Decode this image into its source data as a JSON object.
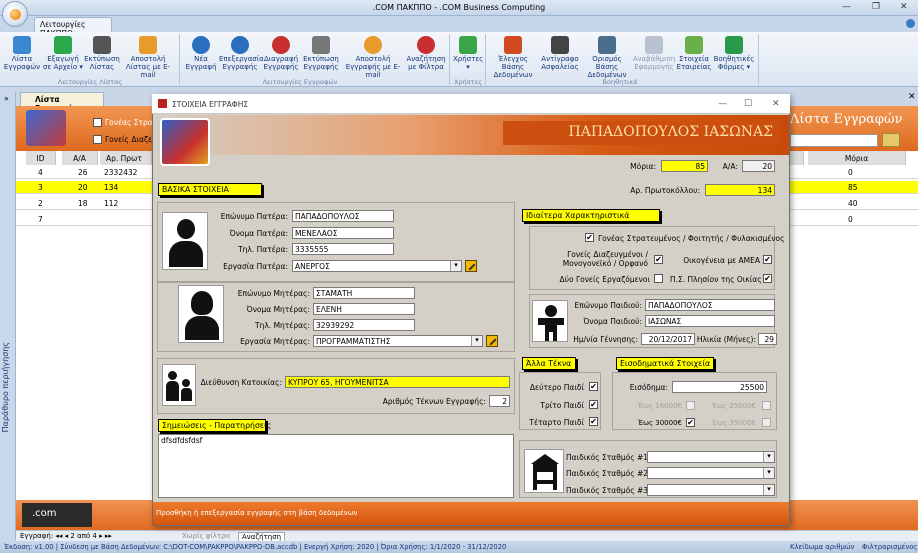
{
  "window": {
    "title": ".COM ΠΑΚΠΠΟ - .COM Business Computing"
  },
  "tabs": {
    "main": "Λειτουργίες ΠΑΚΠΠΟ"
  },
  "ribbon": {
    "buttons": [
      {
        "l1": "Λίστα",
        "l2": "Εγγραφών"
      },
      {
        "l1": "Εξαγωγή",
        "l2": "σε Αρχείο ▾"
      },
      {
        "l1": "Εκτύπωση",
        "l2": "Λίστας"
      },
      {
        "l1": "Αποστολή",
        "l2": "Λίστας με E-mail"
      },
      {
        "l1": "Νέα",
        "l2": "Εγγραφή"
      },
      {
        "l1": "Επεξεργασία",
        "l2": "Εγγραφής"
      },
      {
        "l1": "Διαγραφή",
        "l2": "Εγγραφής"
      },
      {
        "l1": "Εκτύπωση",
        "l2": "Εγγραφής"
      },
      {
        "l1": "Αποστολή",
        "l2": "Εγγραφής με E-mail"
      },
      {
        "l1": "Αναζήτηση",
        "l2": "με Φίλτρα"
      },
      {
        "l1": "Χρήστες",
        "l2": "▾"
      },
      {
        "l1": "Έλεγχος Βάσης",
        "l2": "Δεδομένων"
      },
      {
        "l1": "Αντίγραφο",
        "l2": "Ασφαλείας"
      },
      {
        "l1": "Ορισμός Βάσης",
        "l2": "Δεδομένων"
      },
      {
        "l1": "Αναβάθμιση",
        "l2": "Εφαρμογής"
      },
      {
        "l1": "Στοιχεία",
        "l2": "Εταιρείας"
      },
      {
        "l1": "Βοηθητικές",
        "l2": "Φόρμες ▾"
      }
    ],
    "groups": [
      "Λειτουργίες Λίστας",
      "Λειτουργίες Εγγραφών",
      "Χρήστες",
      "Βοηθητικά"
    ]
  },
  "nav": {
    "pane": "Παράθυρο περιήγησης",
    "collapse": "»"
  },
  "list": {
    "tab": "Λίστα Εγγραφών",
    "title": "Λίστα Εγγραφών",
    "filter1": "Γονέας Στρατ",
    "filter2": "Γονείς Διαζευγ",
    "columns": [
      "ID",
      "Α/Α",
      "Αρ. Πρωτ",
      "Μόρια"
    ],
    "rows": [
      {
        "id": "4",
        "aa": "26",
        "ap": "2332432",
        "moria": "0"
      },
      {
        "id": "3",
        "aa": "20",
        "ap": "134",
        "moria": "85"
      },
      {
        "id": "2",
        "aa": "18",
        "ap": "112",
        "moria": "40"
      },
      {
        "id": "7",
        "aa": "",
        "ap": "",
        "moria": "0"
      }
    ],
    "recnav": "Εγγραφή: ◂◂ ◂ 2 από 4 ▸ ▸▸",
    "nofilter": "Χωρίς φίλτρο",
    "search": "Αναζήτηση",
    "logo": ".com"
  },
  "dialog": {
    "title": "ΣΤΟΙΧΕΙΑ ΕΓΓΡΑΦΗΣ",
    "name": "ΠΑΠΑΔΟΠΟΥΛΟΣ ΙΑΣΩΝΑΣ",
    "moria_label": "Μόρια:",
    "moria": "85",
    "aa_label": "Α/Α:",
    "aa": "20",
    "protocol_label": "Αρ. Πρωτοκόλλου:",
    "protocol": "134",
    "basic": "ΒΑΣΙΚΑ ΣΤΟΙΧΕΙΑ",
    "father": {
      "surname_label": "Επώνυμο Πατέρα:",
      "surname": "ΠΑΠΑΔΟΠΟΥΛΟΣ",
      "name_label": "Όνομα Πατέρα:",
      "name": "ΜΕΝΕΛΑΟΣ",
      "phone_label": "Τηλ. Πατέρα:",
      "phone": "3335555",
      "job_label": "Εργασία Πατέρα:",
      "job": "ΑΝΕΡΓΟΣ"
    },
    "mother": {
      "surname_label": "Επώνυμο Μητέρας:",
      "surname": "ΣΤΑΜΑΤΗ",
      "name_label": "Όνομα Μητέρας:",
      "name": "ΕΛΕΝΗ",
      "phone_label": "Τηλ. Μητέρας:",
      "phone": "32939292",
      "job_label": "Εργασία Μητέρας:",
      "job": "ΠΡΟΓΡΑΜΜΑΤΙΣΤΗΣ"
    },
    "address_label": "Διεύθυνση Κατοικίας:",
    "address": "ΚΥΠΡΟΥ 65, ΗΓΟΥΜΕΝΙΤΣΑ",
    "children_count_label": "Αριθμός Τέκνων Εγγραφής:",
    "children_count": "2",
    "notes_title": "Σημειώσεις - Παρατηρήσεις",
    "notes": "dfsdfdsfdsf",
    "special": {
      "title": "Ιδιαίτερα Χαρακτηριστικά",
      "military": "Γονέας Στρατευμένος / Φοιτητής / Φυλακισμένος",
      "divorced1": "Γονείς Διαζευγμένοι /",
      "divorced2": "Μονογονεϊκό / Ορφανό",
      "amea": "Οικογένεια με ΑΜΕΑ",
      "twoworking": "Δύο Γονείς Εργαζόμενοι",
      "near": "Π.Σ. Πλησίον της Οικίας"
    },
    "child": {
      "surname_label": "Επώνυμο Παιδιού:",
      "surname": "ΠΑΠΑΔΟΠΟΥΛΟΣ",
      "name_label": "Όνομα Παιδιού:",
      "name": "ΙΑΣΩΝΑΣ",
      "dob_label": "Ημ/νία Γέννησης:",
      "dob": "20/12/2017",
      "age_label": "Ηλικία (Μήνες):",
      "age": "29"
    },
    "other": {
      "title": "Άλλα Τέκνα",
      "second": "Δεύτερο Παιδί",
      "third": "Τρίτο Παιδί",
      "fourth": "Τέταρτο Παιδί"
    },
    "income": {
      "title": "Εισοδηματικά Στοιχεία",
      "label": "Εισόδημα:",
      "value": "25500",
      "r1": "Έως 16000€",
      "r2": "Έως 25000€",
      "r3": "Έως 30000€",
      "r4": "Έως 35000€"
    },
    "nursery": {
      "n1": "Παιδικός Σταθμός #1",
      "n2": "Παιδικός Σταθμός #2",
      "n3": "Παιδικός Σταθμός #3"
    },
    "footer": "Προσθήκη ή επεξεργασία εγγραφής στη βάση δεδομένων"
  },
  "status": {
    "left": "Έκδοση: v1.00 | Σύνδεση με Βάση Δεδομένων: C:\\DOT-COM\\PAKPPO\\PAKPPO-DB.accdb | Ενεργή Χρήση: 2020 | Όρια Χρήσης: 1/1/2020 - 31/12/2020",
    "numlock": "Κλείδωμα αριθμών",
    "filtered": "Φιλτραρισμένος"
  }
}
